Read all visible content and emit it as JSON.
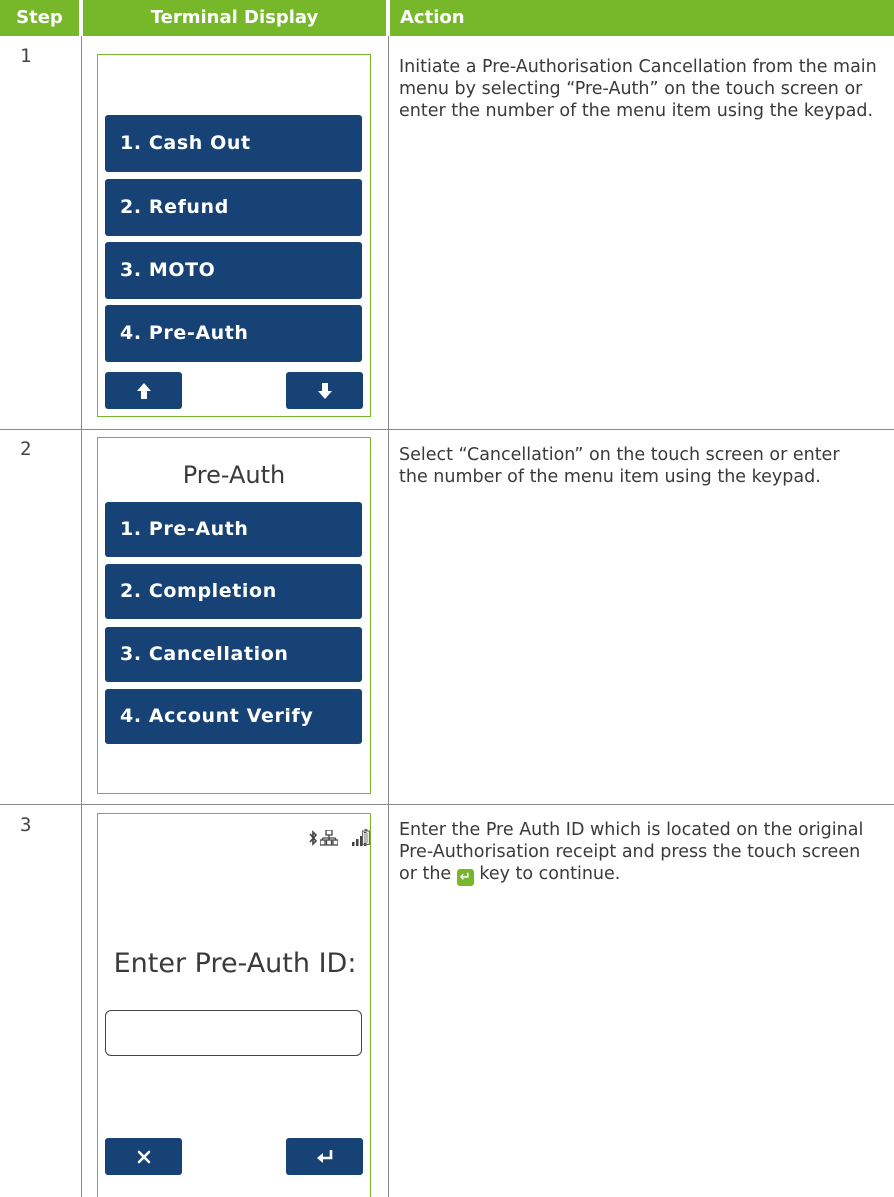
{
  "header": {
    "step": "Step",
    "terminal_display": "Terminal Display",
    "action": "Action"
  },
  "rows": [
    {
      "step": "1",
      "menu": [
        "1. Cash Out",
        "2. Refund",
        "3. MOTO",
        "4. Pre-Auth"
      ],
      "nav": {
        "up_icon": "arrow-up-icon",
        "down_icon": "arrow-down-icon"
      },
      "action": "Initiate a Pre-Authorisation Cancellation from the main menu by selecting “Pre-Auth” on the touch screen or enter the number of the menu item using the keypad."
    },
    {
      "step": "2",
      "screen_title": "Pre-Auth",
      "menu": [
        "1. Pre-Auth",
        "2. Completion",
        "3. Cancellation",
        "4. Account Verify"
      ],
      "action": "Select “Cancellation” on the touch screen or enter the number of the menu item using the keypad."
    },
    {
      "step": "3",
      "status_icons": [
        "bluetooth-icon",
        "network-icon",
        "signal-icon",
        "battery-icon"
      ],
      "prompt": "Enter Pre-Auth ID:",
      "input_value": "",
      "cancel_icon": "x-icon",
      "enter_icon": "enter-key-icon",
      "action_before": "Enter the Pre Auth ID which is located on the original Pre-Authorisation receipt and press the touch screen or the",
      "action_after": "key to continue."
    }
  ],
  "colors": {
    "header_green": "#76b82a",
    "button_blue": "#174276",
    "border_green": "#76b82a"
  }
}
